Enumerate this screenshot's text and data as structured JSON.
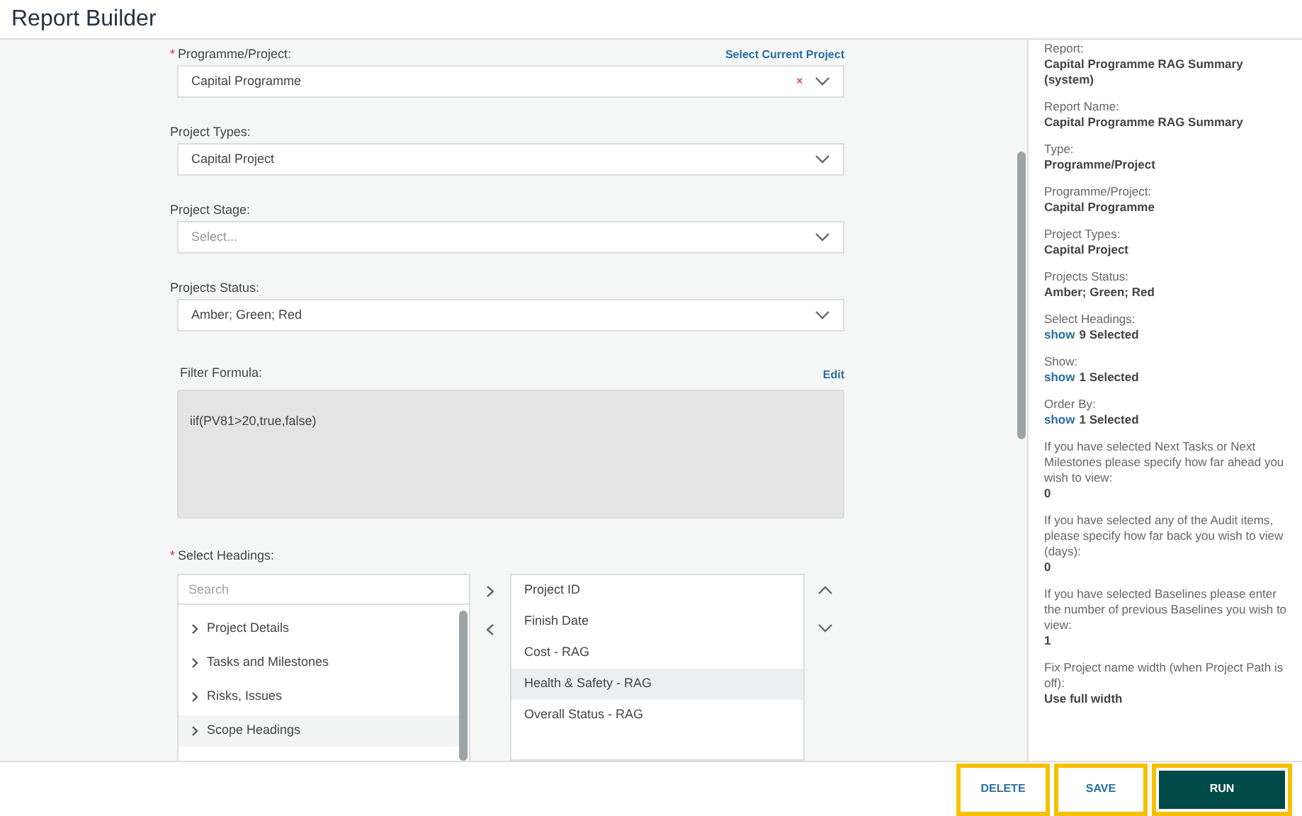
{
  "title": "Report Builder",
  "form": {
    "fields": [
      {
        "required_mark": "*",
        "label": "Programme/Project:",
        "action": "Select Current Project",
        "value": "Capital Programme",
        "clear": "×"
      },
      {
        "label": "Project Types:",
        "value": "Capital Project"
      },
      {
        "label": "Project Stage:",
        "placeholder": "Select..."
      },
      {
        "label": "Projects Status:",
        "value": "Amber; Green; Red"
      }
    ],
    "formula": {
      "label": "Filter Formula:",
      "action": "Edit",
      "value": "iif(PV81>20,true,false)"
    },
    "headings": {
      "required_mark": "*",
      "label": "Select Headings:",
      "search_placeholder": "Search",
      "available": [
        {
          "label": "Project Details",
          "selected": false
        },
        {
          "label": "Tasks and Milestones",
          "selected": false
        },
        {
          "label": "Risks, Issues",
          "selected": false
        },
        {
          "label": "Scope Headings",
          "selected": true
        }
      ],
      "chosen": [
        {
          "label": "Project ID",
          "selected": false
        },
        {
          "label": "Finish Date",
          "selected": false
        },
        {
          "label": "Cost - RAG",
          "selected": false
        },
        {
          "label": "Health & Safety - RAG",
          "selected": true
        },
        {
          "label": "Overall Status - RAG",
          "selected": false
        }
      ]
    }
  },
  "summary": [
    {
      "label": "Report:",
      "value": "Capital Programme RAG Summary (system)"
    },
    {
      "label": "Report Name:",
      "value": "Capital Programme RAG Summary"
    },
    {
      "label": "Type:",
      "value": "Programme/Project"
    },
    {
      "label": "Programme/Project:",
      "value": "Capital Programme"
    },
    {
      "label": "Project Types:",
      "value": "Capital Project"
    },
    {
      "label": "Projects Status:",
      "value": "Amber; Green; Red"
    },
    {
      "label": "Select Headings:",
      "link": "show",
      "value": "9 Selected"
    },
    {
      "label": "Show:",
      "link": "show",
      "value": "1 Selected"
    },
    {
      "label": "Order By:",
      "link": "show",
      "value": "1 Selected"
    },
    {
      "label": "If you have selected Next Tasks or Next Milestones please specify how far ahead you wish to view:",
      "value": "0"
    },
    {
      "label": "If you have selected any of the Audit items, please specify how far back you wish to view (days):",
      "value": "0"
    },
    {
      "label": "If you have selected Baselines please enter the number of previous Baselines you wish to view:",
      "value": "1"
    },
    {
      "label": "Fix Project name width (when Project Path is off):",
      "value": "Use full width"
    }
  ],
  "buttons": [
    {
      "label": "DELETE",
      "kind": "plain",
      "highlighted": true
    },
    {
      "label": "SAVE",
      "kind": "plain",
      "highlighted": true
    },
    {
      "label": "RUN",
      "kind": "primary",
      "highlighted": true
    }
  ]
}
